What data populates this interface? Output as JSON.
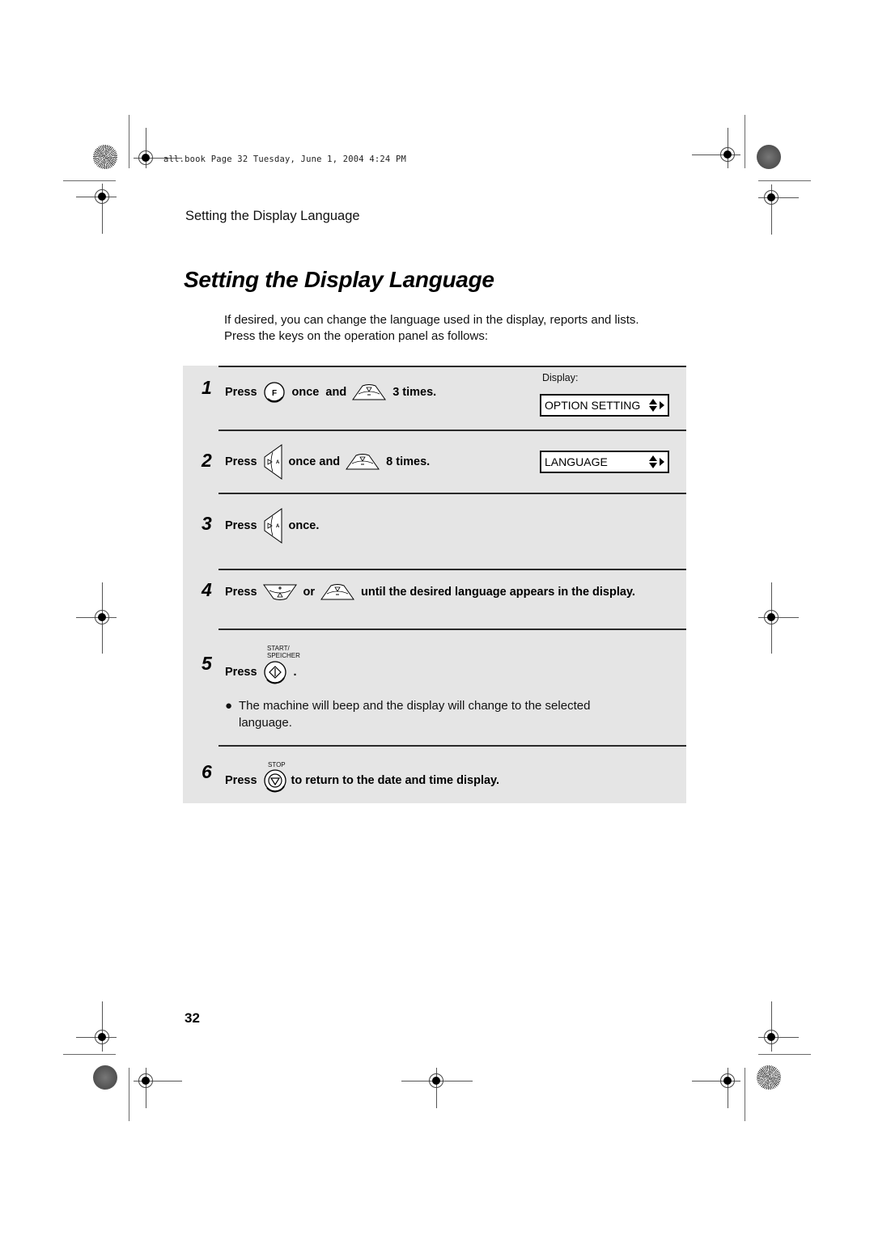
{
  "print_header": {
    "text": "all.book  Page 32  Tuesday, June 1, 2004  4:24 PM"
  },
  "running_head": "Setting the Display Language",
  "title": "Setting the Display Language",
  "intro": {
    "line1": "If desired, you can change the language used in the display, reports and lists.",
    "line2": "Press the keys on the operation panel as follows:"
  },
  "display_label": "Display:",
  "displays": {
    "step1": "OPTION SETTING",
    "step2": "LANGUAGE"
  },
  "steps": [
    {
      "number": "1",
      "press": "Press",
      "key1_icon": "f-key-icon",
      "mid": "once  and",
      "key2_icon": "down-arrow-key-icon",
      "end": "3 times."
    },
    {
      "number": "2",
      "press": "Press",
      "key1_icon": "right-arrow-key-icon",
      "mid": "once and",
      "key2_icon": "down-arrow-key-icon",
      "end": "8 times."
    },
    {
      "number": "3",
      "press": "Press",
      "key1_icon": "right-arrow-key-icon",
      "end": "once."
    },
    {
      "number": "4",
      "press": "Press",
      "key1_icon": "up-arrow-key-icon",
      "mid": "or",
      "key2_icon": "down-arrow-key-icon",
      "end": "until the desired language appears in the display."
    },
    {
      "number": "5",
      "press": "Press",
      "key_label_top": "START/",
      "key_label_bottom": "SPEICHER",
      "key1_icon": "start-key-icon",
      "end": ".",
      "bullet": "The machine will beep and the display will change to the selected",
      "bullet_cont": "language."
    },
    {
      "number": "6",
      "press": "Press",
      "key_label_top": "STOP",
      "key1_icon": "stop-key-icon",
      "end": "to return to the date and time display."
    }
  ],
  "page_number": "32"
}
